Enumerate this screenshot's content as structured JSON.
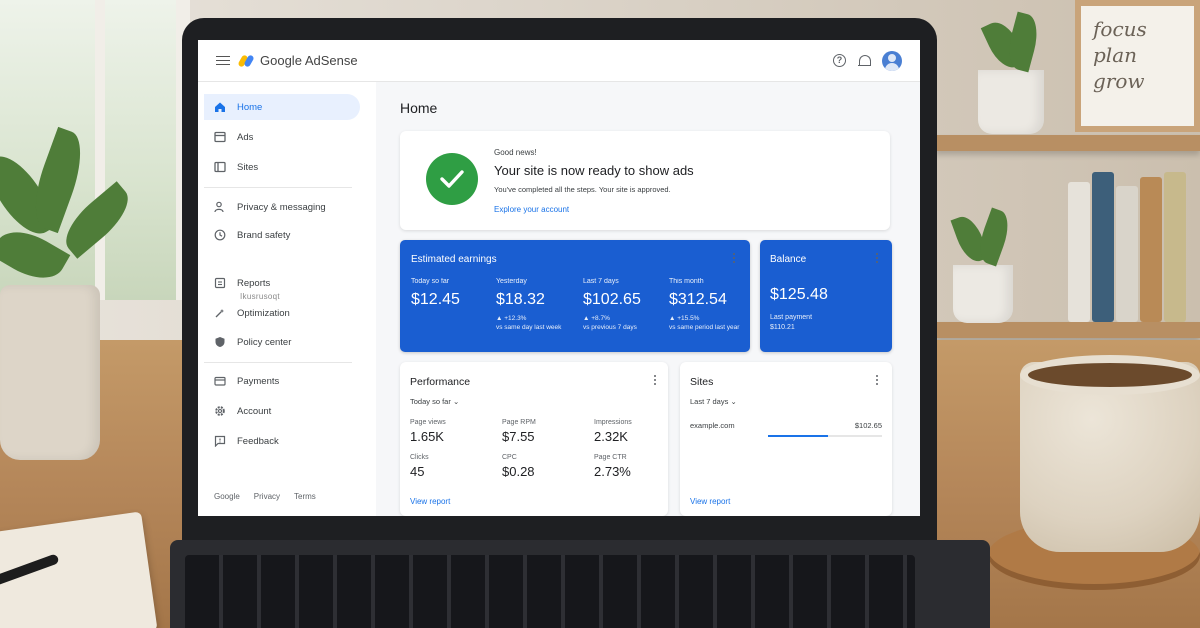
{
  "app": {
    "brand": "Google AdSense"
  },
  "sidebar": {
    "items": [
      {
        "label": "Home",
        "icon": "home-icon",
        "active": true
      },
      {
        "label": "Ads",
        "icon": "ads-icon"
      },
      {
        "label": "Sites",
        "icon": "sites-icon"
      },
      {
        "label": "Privacy & messaging",
        "icon": "person-shield-icon"
      },
      {
        "label": "Brand safety",
        "icon": "clock-icon"
      },
      {
        "label": "Reports",
        "icon": "report-icon"
      },
      {
        "label": "Optimization",
        "icon": "optimization-icon"
      },
      {
        "label": "Policy center",
        "icon": "shield-icon"
      },
      {
        "label": "Payments",
        "icon": "payments-icon"
      },
      {
        "label": "Account",
        "icon": "gear-icon"
      },
      {
        "label": "Feedback",
        "icon": "feedback-icon"
      }
    ],
    "ghost_text": "Ikusrusoqt",
    "footer": [
      "Google",
      "Privacy",
      "Terms"
    ]
  },
  "main": {
    "title": "Home",
    "banner": {
      "kicker": "Good news!",
      "headline": "Your site is now ready to show ads",
      "sub": "You've completed all the steps. Your site is approved.",
      "link": "Explore your account"
    },
    "earnings": {
      "title": "Estimated earnings",
      "metrics": [
        {
          "label": "Today so far",
          "value": "$12.45",
          "delta": "",
          "compare": ""
        },
        {
          "label": "Yesterday",
          "value": "$18.32",
          "delta": "▲ +12.3%",
          "compare": "vs same day last week"
        },
        {
          "label": "Last 7 days",
          "value": "$102.65",
          "delta": "▲ +8.7%",
          "compare": "vs previous 7 days"
        },
        {
          "label": "This month",
          "value": "$312.54",
          "delta": "▲ +15.5%",
          "compare": "vs same period last year"
        }
      ]
    },
    "balance": {
      "title": "Balance",
      "value": "$125.48",
      "last_label": "Last payment",
      "last_value": "$110.21"
    },
    "performance": {
      "title": "Performance",
      "range": "Today so far",
      "metrics": [
        {
          "label": "Page views",
          "value": "1.65K"
        },
        {
          "label": "Page RPM",
          "value": "$7.55"
        },
        {
          "label": "Impressions",
          "value": "2.32K"
        },
        {
          "label": "Clicks",
          "value": "45"
        },
        {
          "label": "CPC",
          "value": "$0.28"
        },
        {
          "label": "Page CTR",
          "value": "2.73%"
        }
      ],
      "link": "View report"
    },
    "sites": {
      "title": "Sites",
      "range": "Last 7 days",
      "rows": [
        {
          "site": "example.com",
          "amount": "$102.65",
          "share": 0.53
        }
      ],
      "link": "View report"
    }
  },
  "background": {
    "frame_text": "focus plan grow"
  },
  "colors": {
    "accent": "#1a73e8",
    "card_blue": "#1a5ed1",
    "success": "#2f9e44"
  }
}
